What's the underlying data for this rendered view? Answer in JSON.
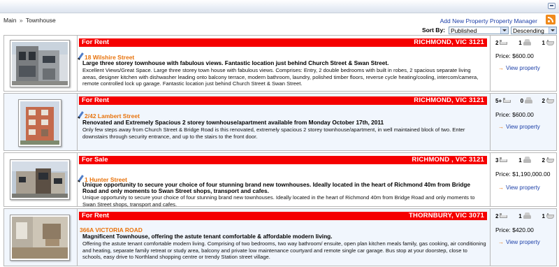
{
  "breadcrumb": {
    "root": "Main",
    "separator": "»",
    "current": "Townhouse"
  },
  "links": {
    "add_new": "Add New Property",
    "manager": "Property Manager"
  },
  "sort": {
    "label": "Sort By:",
    "field": "Published",
    "order": "Descending"
  },
  "listings": [
    {
      "type": "For Rent",
      "location": "RICHMOND, VIC 3121",
      "address": "18 Wilshire Street",
      "headline": "Large three storey townhouse with fabulous views. Fantastic location just behind Church Street & Swan Street.",
      "description": "Excellent Views/Great Space. Large three storey town house with fabulous views. Comprises: Entry, 2 double bedrooms with built in robes, 2 spacious separate living areas, designer kitchen with dishwasher leading onto balcony terrace, modern bathroom, laundry, polished timber floors, reverse cycle heating/cooling, intercom/camera, remote controlled lock up garage. Fantastic location just behind Church Street & Swan Street.",
      "bedrooms": "2",
      "cars": "1",
      "bathrooms": "1",
      "price": "Price: $600.00",
      "view": "View property"
    },
    {
      "type": "For Rent",
      "location": "RICHMOND, VIC 3121",
      "address": "2/42 Lambert Street",
      "headline": "Renovated and Extremely Spacious 2 storey townhouse/apartment available from Monday October 17th, 2011",
      "description": "Only few steps away from Church Street & Bridge Road is this renovated, extremely spacious 2 storey townhouse/apartment, in well maintained block of two. Enter downstairs through security entrance, and up to the stairs to the front door.",
      "bedrooms": "5+",
      "cars": "0",
      "bathrooms": "2",
      "price": "Price: $600.00",
      "view": "View property"
    },
    {
      "type": "For Sale",
      "location": "RICHMOND , VIC 3121",
      "address": "1 Hunter Street",
      "headline": "Unique opportunity to secure your choice of four stunning brand new townhouses. Ideally located in the heart of Richmond 40m from Bridge Road and only moments to Swan Street shops, transport and cafes.",
      "description": "Unique opportunity to secure your choice of four stunning brand new townhouses. Ideally located in the heart of Richmond 40m from Bridge Road and only moments to Swan Street shops, transport and cafes.",
      "bedrooms": "3",
      "cars": "1",
      "bathrooms": "2",
      "price": "Price: $1,190,000.00",
      "view": "View property"
    },
    {
      "type": "For Rent",
      "location": "THORNBURY, VIC 3071",
      "address": "366A VICTORIA ROAD",
      "headline": "Magnificent Townhouse, offering the astute tenant comfortable & affordable modern living.",
      "description": "Offering the astute tenant comfortable modern living. Comprising of two bedrooms, two way bathroom/ ensuite, open plan kitchen meals family, gas cooking, air conditioning and heating, separate family retreat or study area, balcony and private low maintenance courtyard and remote single car garage. Bus stop at your doorstep, close to schools, easy drive to Northland shopping centre or trendy Station street village.",
      "bedrooms": "2",
      "cars": "1",
      "bathrooms": "1",
      "price": "Price: $420.00",
      "view": "View property"
    }
  ]
}
